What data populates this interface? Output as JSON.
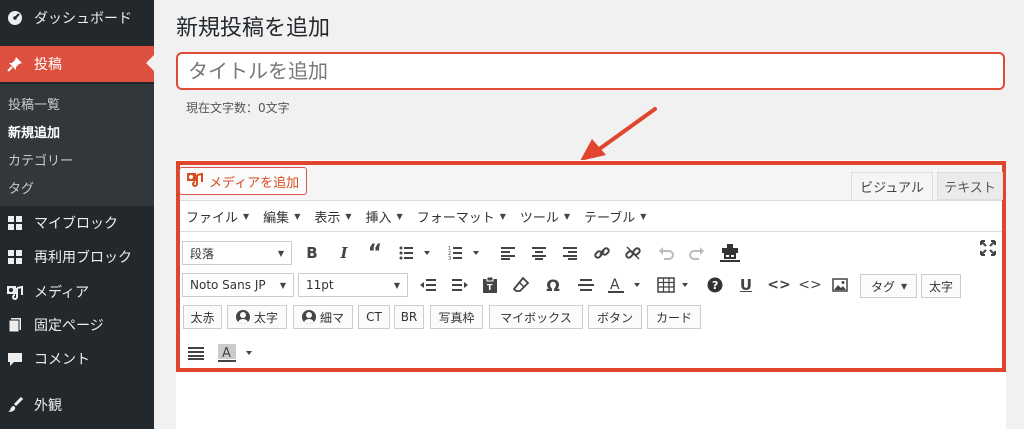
{
  "sidebar": {
    "items": [
      {
        "label": "ダッシュボード",
        "icon": "dashboard-icon"
      },
      {
        "label": "投稿",
        "icon": "pin-icon",
        "active": true
      },
      {
        "label": "マイブロック",
        "icon": "grid-icon"
      },
      {
        "label": "再利用ブロック",
        "icon": "grid-icon"
      },
      {
        "label": "メディア",
        "icon": "media-icon"
      },
      {
        "label": "固定ページ",
        "icon": "page-icon"
      },
      {
        "label": "コメント",
        "icon": "comment-icon"
      },
      {
        "label": "外観",
        "icon": "brush-icon"
      }
    ],
    "submenu": [
      "投稿一覧",
      "新規追加",
      "カテゴリー",
      "タグ"
    ]
  },
  "page": {
    "title": "新規投稿を追加",
    "title_placeholder": "タイトルを追加",
    "char_count": "現在文字数：0文字"
  },
  "editor": {
    "add_media": "メディアを追加",
    "tabs": [
      "ビジュアル",
      "テキスト"
    ],
    "menubar": [
      "ファイル",
      "編集",
      "表示",
      "挿入",
      "フォーマット",
      "ツール",
      "テーブル"
    ],
    "format_select": "段落",
    "font_select": "Noto Sans JP",
    "size_select": "11pt",
    "tag_select": "タグ",
    "buttons_row2": [
      "太字"
    ],
    "buttons_row3": [
      "太赤",
      "太字",
      "細マ",
      "CT",
      "BR",
      "写真枠",
      "マイボックス",
      "ボタン",
      "カード"
    ]
  },
  "colors": {
    "sidebar_bg": "#23282d",
    "active": "#dd5040",
    "highlight": "#e0452d"
  }
}
